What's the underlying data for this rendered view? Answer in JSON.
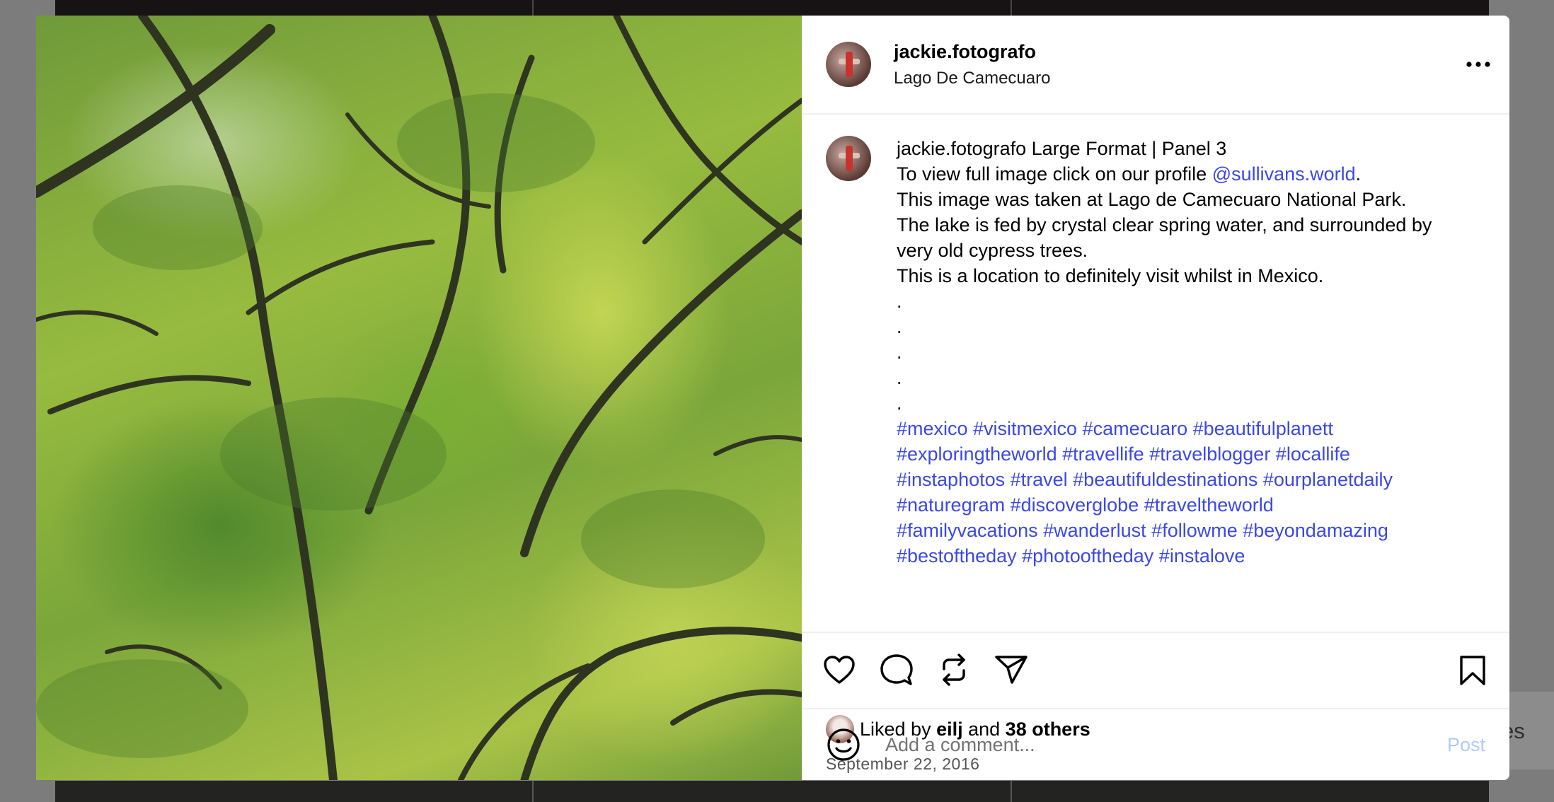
{
  "background": {
    "right_card_text": "es"
  },
  "post": {
    "header": {
      "username": "jackie.fotografo",
      "location": "Lago De Camecuaro"
    },
    "caption": {
      "username": "jackie.fotografo",
      "title": "Large Format | Panel 3",
      "line1_prefix": "To view full image click on our profile ",
      "line1_mention": "@sullivans.world",
      "line1_suffix": ".",
      "line2": "This image was taken at Lago de Camecuaro National Park.",
      "line3": "The lake is fed by crystal clear spring water, and surrounded by very old cypress trees.",
      "line4": "This is a location to definitely visit whilst in Mexico.",
      "dots": [
        ".",
        ".",
        ".",
        ".",
        "."
      ],
      "hashtags": [
        "#mexico #visitmexico #camecuaro #beautifulplanett",
        "#exploringtheworld #travellife #travelblogger #locallife",
        "#instaphotos #travel #beautifuldestinations #ourplanetdaily",
        "#naturegram #discoverglobe #traveltheworld",
        "#familyvacations #wanderlust #followme #beyondamazing",
        "#bestoftheday #photooftheday #instalove"
      ]
    },
    "likes": {
      "prefix": "Liked by ",
      "user": "eilj",
      "middle": " and ",
      "others": "38 others"
    },
    "date": "September 22, 2016",
    "comment": {
      "placeholder": "Add a comment...",
      "post_label": "Post"
    }
  },
  "icons": {
    "more": "more-horizontal-icon",
    "like": "heart-icon",
    "comment": "comment-bubble-icon",
    "repost": "repost-icon",
    "share": "paper-plane-icon",
    "save": "bookmark-icon",
    "emoji": "smiley-icon"
  },
  "colors": {
    "link": "#3b48e8",
    "post_button_disabled": "#b1c9f7",
    "divider": "#efefef"
  }
}
